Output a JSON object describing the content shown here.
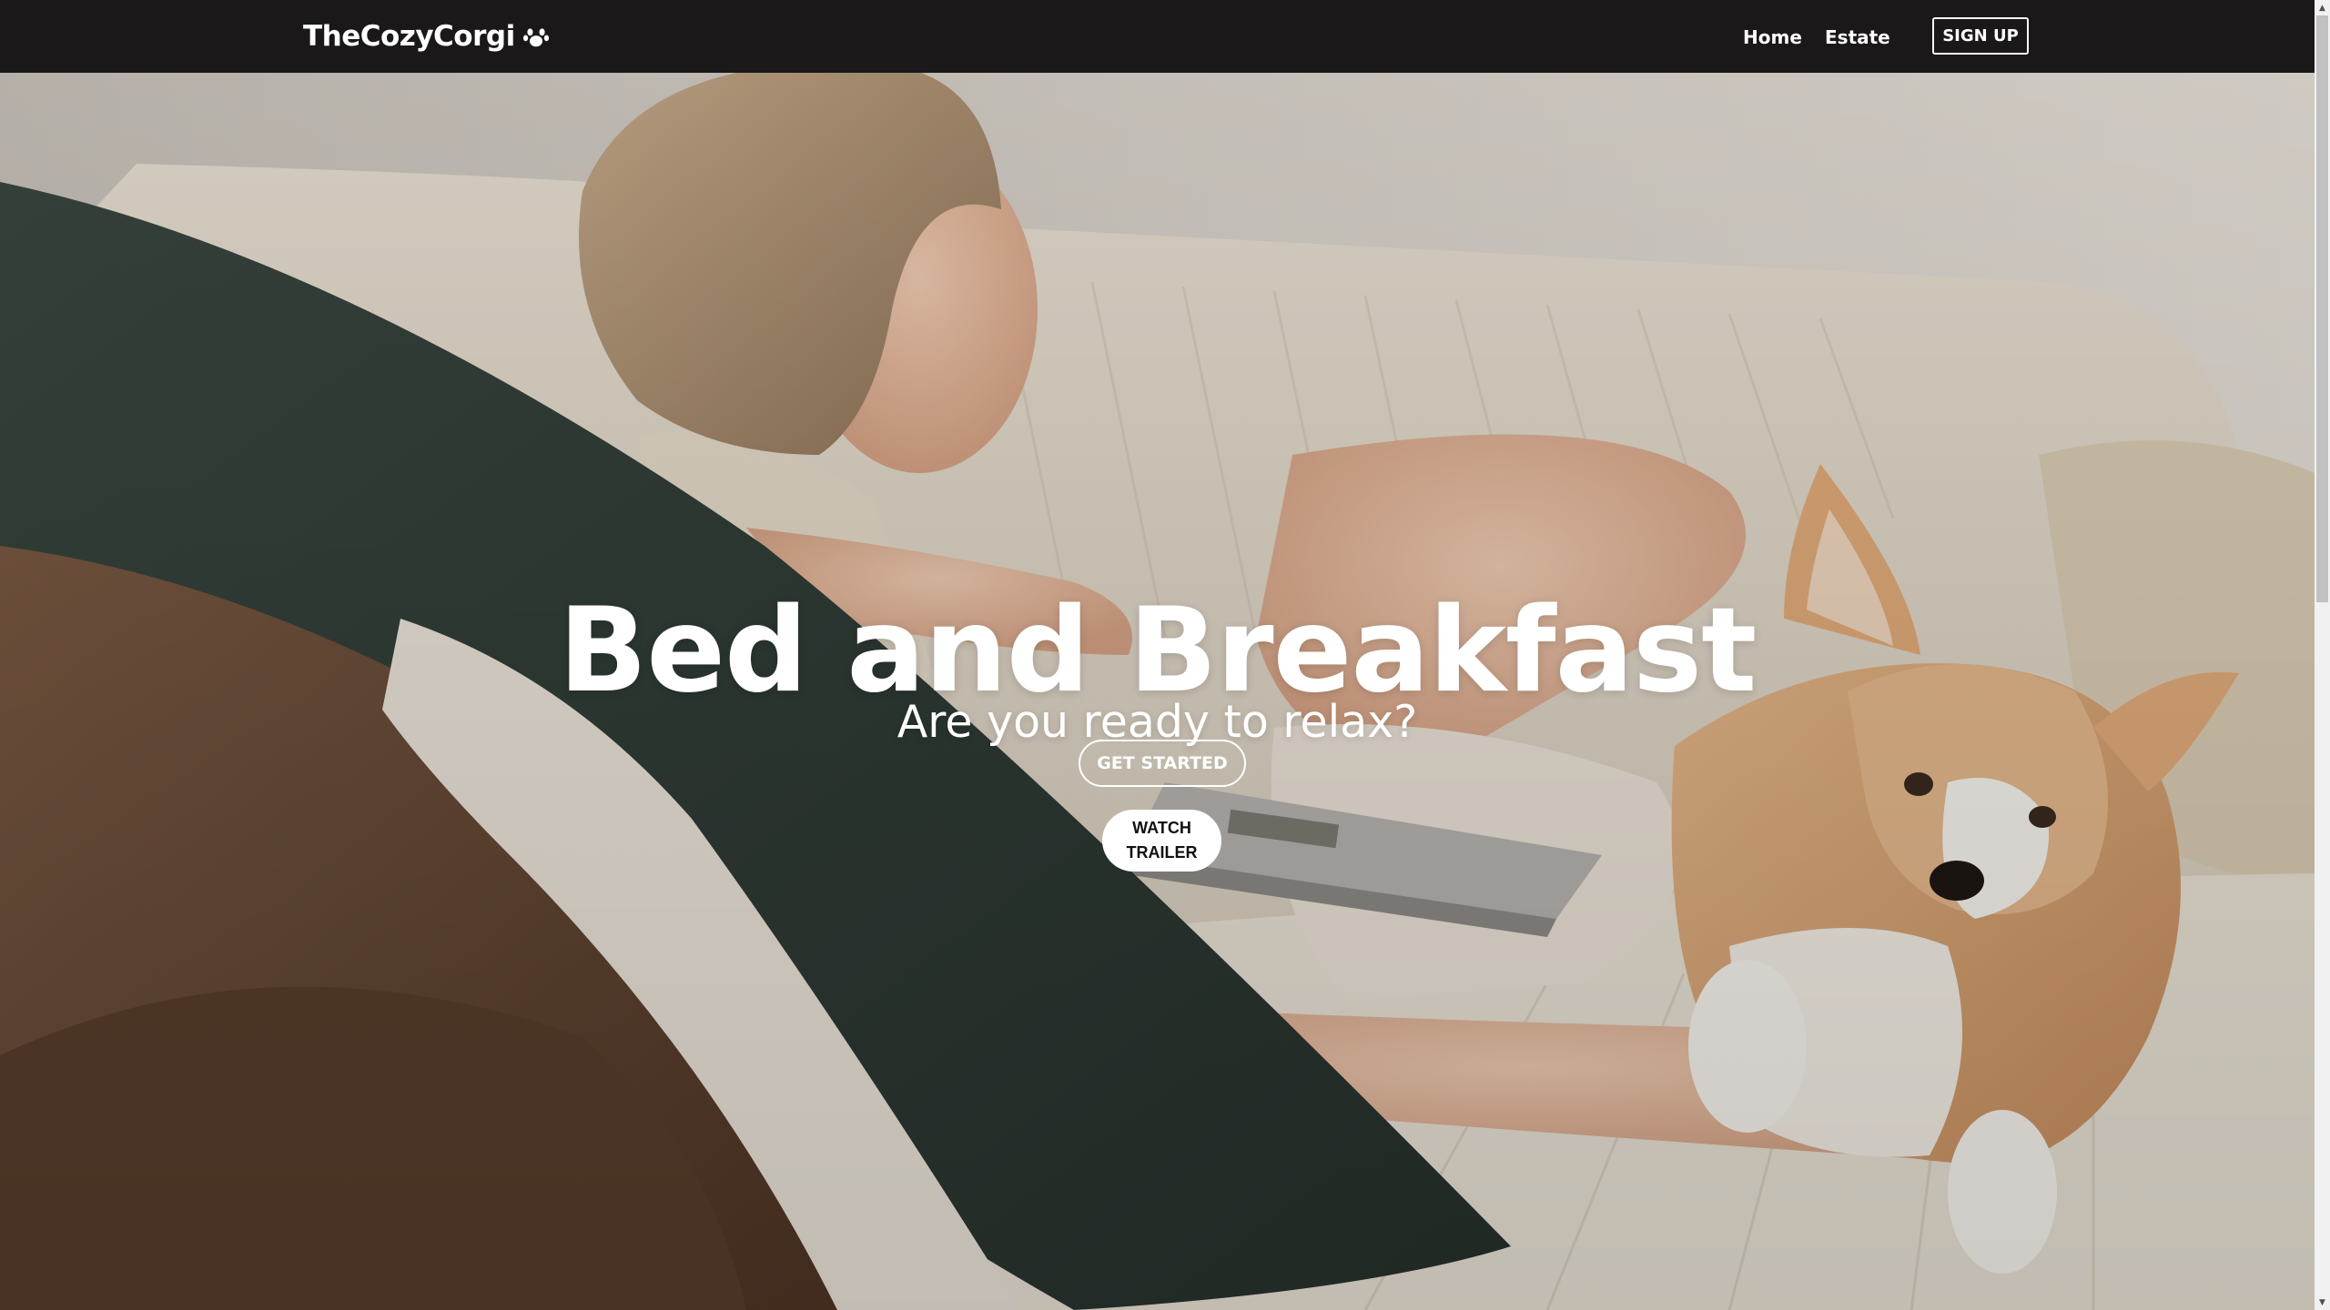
{
  "navbar": {
    "brand": "TheCozyCorgi",
    "brand_icon": "paw-icon",
    "links": [
      {
        "label": "Home"
      },
      {
        "label": "Estate"
      }
    ],
    "signup_label": "SIGN UP"
  },
  "hero": {
    "title": "Bed and Breakfast",
    "subtitle": "Are you ready to relax?",
    "get_started_label": "GET STARTED",
    "watch_trailer_label": "WATCH TRAILER",
    "background_image": "woman-with-laptop-and-corgi-on-sofa"
  },
  "colors": {
    "navbar_bg": "#1b1819",
    "text_on_dark": "#ffffff",
    "button_light_bg": "#ffffff"
  }
}
